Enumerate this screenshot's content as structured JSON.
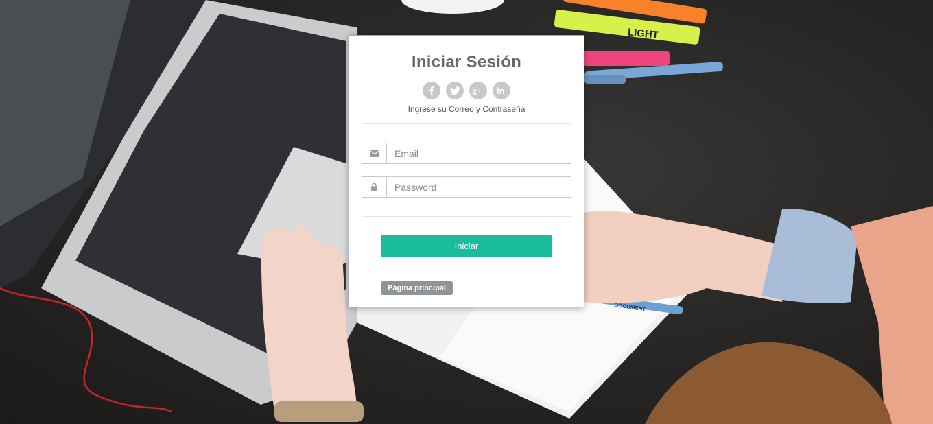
{
  "login": {
    "title": "Iniciar Sesión",
    "subtitle": "Ingrese su Correo y Contraseña",
    "social_icons": [
      "facebook-icon",
      "twitter-icon",
      "google-plus-icon",
      "linkedin-icon"
    ],
    "email": {
      "placeholder": "Email",
      "value": "",
      "icon": "envelope-icon"
    },
    "password": {
      "placeholder": "Password",
      "value": "",
      "icon": "lock-icon"
    },
    "submit_label": "Iniciar",
    "home_label": "Página principal"
  },
  "background": {
    "marker_label": "LIGHT",
    "pen_label": "DOCUMENT"
  },
  "colors": {
    "accent": "#1abc9c",
    "card_top_border": "#8cc63f",
    "home_button": "#8e9497",
    "social_icon_bg": "#c8c8c8"
  }
}
